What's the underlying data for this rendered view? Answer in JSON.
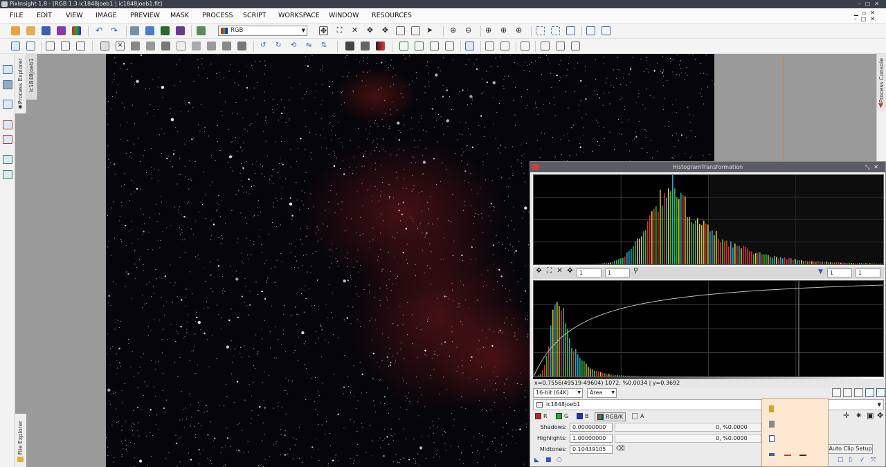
{
  "window": {
    "title": "PixInsight 1.8 - [RGB 1:3 ic1848joeb1 | ic1848joeb1.fit]"
  },
  "menu": [
    "FILE",
    "EDIT",
    "VIEW",
    "IMAGE",
    "PREVIEW",
    "MASK",
    "PROCESS",
    "SCRIPT",
    "WORKSPACE",
    "WINDOW",
    "RESOURCES"
  ],
  "toolbar": {
    "channel_select": "RGB"
  },
  "side_tabs": {
    "process_explorer": "Process Explorer",
    "image_tab": "ic1848joeb1",
    "file_explorer": "File Explorer",
    "process_console": "Process Console"
  },
  "histogram": {
    "title": "HistogramTransformation",
    "zoom_h": "1",
    "zoom_v": "1",
    "out_zoom_h": "1",
    "out_zoom_v": "1",
    "readout": "x=0.7556(49519-49604) 1072, %0.0034 | y=0.3692",
    "bit_depth": "16-bit (64K)",
    "render_mode": "Area",
    "view": "ic1848joeb1",
    "channels": [
      {
        "label": "R",
        "color": "#d42020"
      },
      {
        "label": "G",
        "color": "#22b022"
      },
      {
        "label": "B",
        "color": "#2030d0"
      },
      {
        "label": "RGB/K",
        "color": "#444444"
      },
      {
        "label": "A",
        "color": "#999999"
      }
    ],
    "shadows": {
      "label": "Shadows:",
      "value": "0.00000000",
      "stat": "0, %0.0000"
    },
    "highlights": {
      "label": "Highlights:",
      "value": "1.00000000",
      "stat": "0, %0.0000"
    },
    "midtones": {
      "label": "Midtones:",
      "value": "0.10439105"
    },
    "auto_clip": "Auto Clip Setup"
  },
  "colors": {
    "nebula": "#5a1416",
    "accent": "#3d6fa8"
  }
}
